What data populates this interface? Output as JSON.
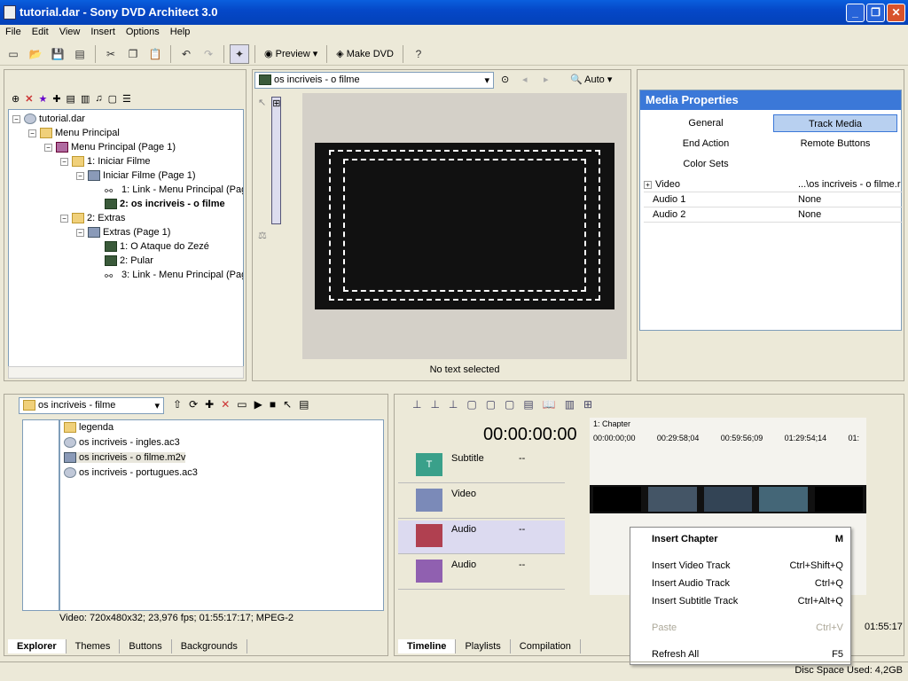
{
  "window": {
    "title": "tutorial.dar - Sony DVD Architect 3.0"
  },
  "menu": [
    "File",
    "Edit",
    "View",
    "Insert",
    "Options",
    "Help"
  ],
  "toolbar": {
    "preview_label": "Preview",
    "make_dvd_label": "Make DVD"
  },
  "project_tree": {
    "items": [
      {
        "label": "tutorial.dar",
        "icon": "disc-icon"
      },
      {
        "label": "Menu Principal",
        "icon": "folder-icon"
      },
      {
        "label": "Menu Principal (Page 1)",
        "icon": "menu-page-icon"
      },
      {
        "label": "1: Iniciar Filme",
        "icon": "folder-icon"
      },
      {
        "label": "Iniciar Filme (Page 1)",
        "icon": "page-icon"
      },
      {
        "label": "1: Link - Menu Principal (Pag",
        "icon": "link-icon"
      },
      {
        "label": "2: os incriveis - o filme",
        "icon": "film-icon"
      },
      {
        "label": "2: Extras",
        "icon": "folder-icon"
      },
      {
        "label": "Extras (Page 1)",
        "icon": "page-icon"
      },
      {
        "label": "1: O Ataque do Zezé",
        "icon": "film-icon"
      },
      {
        "label": "2: Pular",
        "icon": "film-icon"
      },
      {
        "label": "3: Link - Menu Principal (Pag",
        "icon": "link-icon"
      }
    ]
  },
  "preview": {
    "dropdown": "os incriveis - o filme",
    "zoom": "Auto",
    "status": "No text selected"
  },
  "media_properties": {
    "title": "Media Properties",
    "buttons": [
      "General",
      "Track Media",
      "End Action",
      "Remote Buttons",
      "Color Sets"
    ],
    "rows": [
      {
        "name": "Video",
        "value": "...\\os incriveis - o filme.r"
      },
      {
        "name": "Audio 1",
        "value": "None"
      },
      {
        "name": "Audio 2",
        "value": "None"
      }
    ]
  },
  "explorer": {
    "path": "os incriveis - filme",
    "files": [
      {
        "label": "legenda",
        "icon": "folder-icon"
      },
      {
        "label": "os incriveis - ingles.ac3",
        "icon": "audio-icon"
      },
      {
        "label": "os incriveis - o filme.m2v",
        "icon": "video-icon"
      },
      {
        "label": "os incriveis - portugues.ac3",
        "icon": "audio-icon"
      }
    ],
    "info": "Video: 720x480x32; 23,976 fps; 01:55:17:17; MPEG-2",
    "tabs": [
      "Explorer",
      "Themes",
      "Buttons",
      "Backgrounds"
    ]
  },
  "timeline": {
    "timecode": "00:00:00:00",
    "chapter_marker": "1: Chapter",
    "ruler": [
      "00:00:00;00",
      "00:29:58;04",
      "00:59:56;09",
      "01:29:54;14",
      "01:"
    ],
    "tracks": [
      {
        "name": "Subtitle",
        "num": "1",
        "value": "--"
      },
      {
        "name": "Video",
        "num": "1",
        "value": ""
      },
      {
        "name": "Audio",
        "num": "1",
        "value": "--"
      },
      {
        "name": "Audio",
        "num": "2",
        "value": "--"
      }
    ],
    "end_time": "01:55:17",
    "tabs": [
      "Timeline",
      "Playlists",
      "Compilation"
    ]
  },
  "context_menu": {
    "items": [
      {
        "label": "Insert Chapter",
        "shortcut": "M"
      },
      {
        "label": "Insert Video Track",
        "shortcut": "Ctrl+Shift+Q"
      },
      {
        "label": "Insert Audio Track",
        "shortcut": "Ctrl+Q"
      },
      {
        "label": "Insert Subtitle Track",
        "shortcut": "Ctrl+Alt+Q"
      },
      {
        "label": "Paste",
        "shortcut": "Ctrl+V"
      },
      {
        "label": "Refresh All",
        "shortcut": "F5"
      }
    ]
  },
  "statusbar": {
    "disc_space": "Disc Space Used: 4,2GB"
  }
}
